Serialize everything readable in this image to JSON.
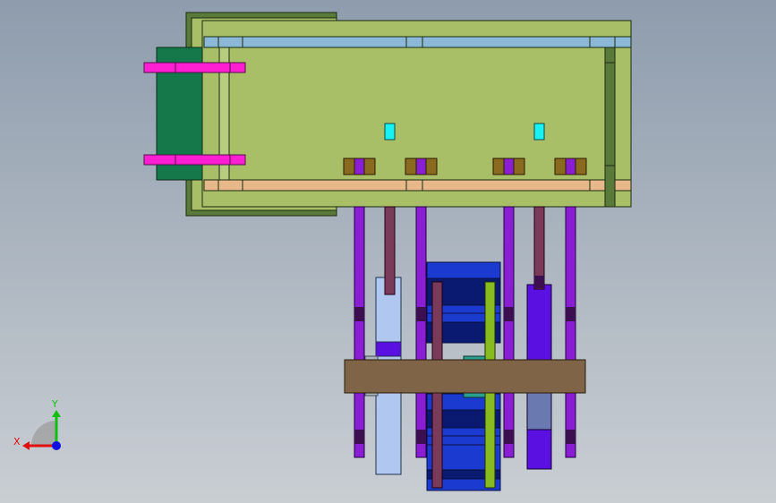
{
  "viewport": {
    "background_top": "#8e9cad",
    "background_bottom": "#c9ced3"
  },
  "colors": {
    "plate_green": "#a8bf68",
    "frame_dark_green": "#5a7a3a",
    "block_green": "#15784a",
    "pink": "#ff1ed2",
    "light_blue": "#8ab8d6",
    "tan": "#e7b98a",
    "cyan": "#19f2f2",
    "olive_brown": "#8a6a1e",
    "purple": "#8a1ed2",
    "dark_purple": "#3c1050",
    "mauve": "#7a3a5a",
    "blue": "#1a3ad0",
    "dark_blue": "#0a1a70",
    "pale_blue": "#b0c8f0",
    "violet": "#5a10e0",
    "brown": "#7f6448",
    "slate": "#6a7ab0",
    "lime": "#88bb20",
    "teal": "#2aa090"
  },
  "triad": {
    "x_label": "X",
    "y_label": "Y",
    "x_color": "#e01010",
    "y_color": "#10c010",
    "z_color": "#1010e0"
  }
}
